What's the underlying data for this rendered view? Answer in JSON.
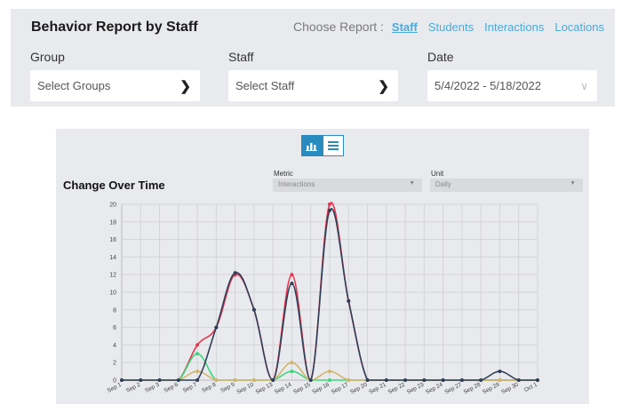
{
  "header": {
    "title": "Behavior Report by Staff",
    "choose_label": "Choose Report :",
    "reports": [
      "Staff",
      "Students",
      "Interactions",
      "Locations"
    ],
    "active_report": "Staff"
  },
  "filters": {
    "group": {
      "label": "Group",
      "value": "Select Groups"
    },
    "staff": {
      "label": "Staff",
      "value": "Select Staff"
    },
    "date": {
      "label": "Date",
      "value": "5/4/2022 - 5/18/2022"
    }
  },
  "chart_panel": {
    "title": "Change Over Time",
    "metric": {
      "label": "Metric",
      "value": "Interactions"
    },
    "unit": {
      "label": "Unit",
      "value": "Daily"
    },
    "toggle": {
      "chart_icon": "bar-chart-icon",
      "list_icon": "list-icon"
    }
  },
  "chart_data": {
    "type": "line",
    "title": "Change Over Time",
    "xlabel": "",
    "ylabel": "",
    "ylim": [
      0,
      20
    ],
    "yticks": [
      0,
      2,
      4,
      6,
      8,
      10,
      12,
      14,
      16,
      18,
      20
    ],
    "grid": true,
    "smooth": true,
    "categories": [
      "Sep 1",
      "Sep 2",
      "Sep 3",
      "Sep 6",
      "Sep 7",
      "Sep 8",
      "Sep 9",
      "Sep 10",
      "Sep 13",
      "Sep 14",
      "Sep 15",
      "Sep 16",
      "Sep 17",
      "Sep 20",
      "Sep 21",
      "Sep 22",
      "Sep 23",
      "Sep 24",
      "Sep 27",
      "Sep 28",
      "Sep 29",
      "Sep 30",
      "Oct 1"
    ],
    "series": [
      {
        "color": "#e8344e",
        "values": [
          0,
          0,
          0,
          0,
          4,
          6,
          12,
          8,
          0,
          12,
          0,
          20,
          9,
          0,
          0,
          0,
          0,
          0,
          0,
          0,
          0,
          0,
          0
        ]
      },
      {
        "color": "#3dd67a",
        "values": [
          0,
          0,
          0,
          0,
          3,
          0,
          0,
          0,
          0,
          1,
          0,
          0,
          0,
          0,
          0,
          0,
          0,
          0,
          0,
          0,
          0,
          0,
          0
        ]
      },
      {
        "color": "#d4b36b",
        "values": [
          0,
          0,
          0,
          0,
          1,
          0,
          0,
          0,
          0,
          2,
          0,
          1,
          0,
          0,
          0,
          0,
          0,
          0,
          0,
          0,
          0,
          0,
          0
        ]
      },
      {
        "color": "#2e3f58",
        "values": [
          0,
          0,
          0,
          0,
          0,
          6,
          12.2,
          8,
          0,
          11,
          0,
          19.3,
          9,
          0,
          0,
          0,
          0,
          0,
          0,
          0,
          1,
          0,
          0
        ]
      }
    ]
  }
}
